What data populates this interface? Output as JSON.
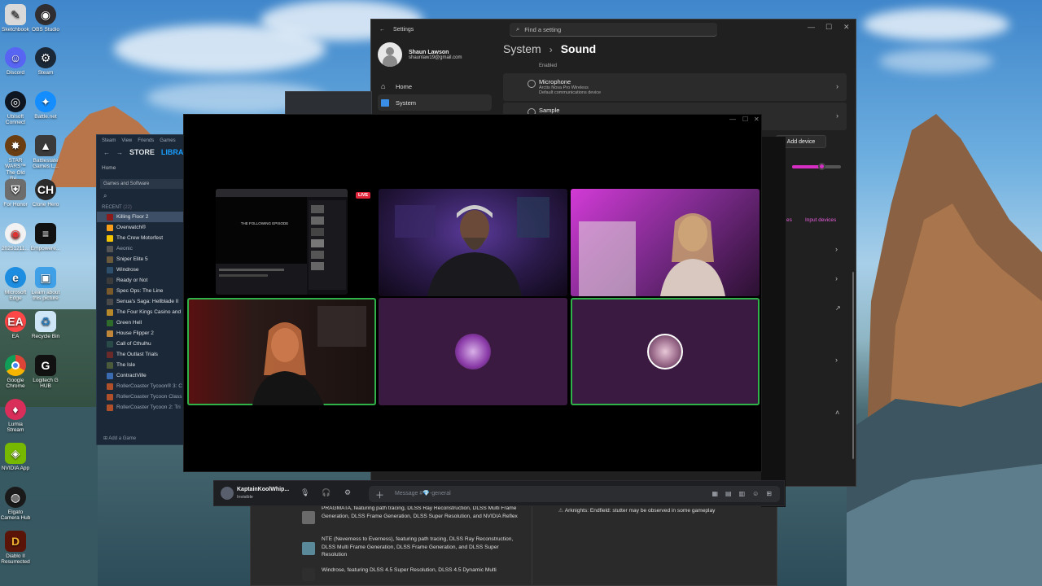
{
  "desktop": {
    "icons": [
      {
        "label": "Sketchbook",
        "icon": "sketch-icon",
        "color": "#d9d9d9"
      },
      {
        "label": "OBS Studio",
        "icon": "obs-icon",
        "color": "#302e31"
      },
      {
        "label": "Discord",
        "icon": "discord-icon",
        "color": "#5865f2"
      },
      {
        "label": "Steam",
        "icon": "steam-icon",
        "color": "#1b2838"
      },
      {
        "label": "Ubisoft Connect",
        "icon": "ubisoft-icon",
        "color": "#0e1621"
      },
      {
        "label": "Battle.net",
        "icon": "battlenet-icon",
        "color": "#148eff"
      },
      {
        "label": "STAR WARS™ The Old Re...",
        "icon": "swtor-icon",
        "color": "#6b3e12"
      },
      {
        "label": "Battlestate Games L...",
        "icon": "battlestate-icon",
        "color": "#3a3a3a"
      },
      {
        "label": "For Honor",
        "icon": "for-honor-icon",
        "color": "#6d6d6d"
      },
      {
        "label": "Clone Hero",
        "icon": "clone-hero-icon",
        "color": "#2b2b2b"
      },
      {
        "label": "20251211...",
        "icon": "chrome-shortcut-icon",
        "color": "#f2f2f2"
      },
      {
        "label": "Empowere...",
        "icon": "empower-icon",
        "color": "#111"
      },
      {
        "label": "Microsoft Edge",
        "icon": "edge-icon",
        "color": "#1c8de0"
      },
      {
        "label": "Learn about this picture",
        "icon": "spotlight-icon",
        "color": "#3fa0e8"
      },
      {
        "label": "EA",
        "icon": "ea-icon",
        "color": "#ff4747"
      },
      {
        "label": "Recycle Bin",
        "icon": "recycle-bin-icon",
        "color": "#cfe6f7"
      },
      {
        "label": "Google Chrome",
        "icon": "chrome-icon",
        "color": "#f2f2f2"
      },
      {
        "label": "Logitech G HUB",
        "icon": "logitech-icon",
        "color": "#111"
      },
      {
        "label": "Lumia Stream",
        "icon": "lumia-icon",
        "color": "#d92d5a"
      },
      {
        "label": "NVIDIA App",
        "icon": "nvidia-icon",
        "color": "#76b900"
      },
      {
        "label": "Elgato Camera Hub",
        "icon": "elgato-icon",
        "color": "#1a1a1a"
      },
      {
        "label": "Diablo II Resurrected",
        "icon": "diablo-icon",
        "color": "#5a1408"
      }
    ]
  },
  "settings": {
    "app_title": "Settings",
    "search_placeholder": "Find a setting",
    "user_name": "Shaun Lawson",
    "user_email": "shaunlaw19@gmail.com",
    "nav": [
      {
        "label": "Home",
        "icon": "home-icon",
        "active": false
      },
      {
        "label": "System",
        "icon": "system-icon",
        "active": true
      }
    ],
    "breadcrumb_parent": "System",
    "breadcrumb_current": "Sound",
    "enabled_label": "Enabled",
    "microphone": {
      "title": "Microphone",
      "subtitle1": "Arctis Nova Pro Wireless",
      "subtitle2": "Default communications device"
    },
    "sample_label": "Sample",
    "add_device_label": "Add device",
    "volume_level": 0.6,
    "input_devices_link": "Input devices",
    "partial_link": "es",
    "accent": "#d62ec3"
  },
  "steam": {
    "menu": [
      "Steam",
      "View",
      "Friends",
      "Games"
    ],
    "tab_store": "STORE",
    "tab_library": "LIBRARY",
    "home_label": "Home",
    "filter_label": "Games and Software",
    "recent_label": "RECENT",
    "recent_count": "(22)",
    "games": [
      {
        "name": "Killing Floor 2",
        "color": "#8b1a1a",
        "selected": true,
        "dim": false
      },
      {
        "name": "Overwatch®",
        "color": "#f99e1a",
        "selected": false,
        "dim": false
      },
      {
        "name": "The Crew Motorfest",
        "color": "#f5c400",
        "selected": false,
        "dim": false
      },
      {
        "name": "Aeonic",
        "color": "#555",
        "selected": false,
        "dim": true
      },
      {
        "name": "Sniper Elite 5",
        "color": "#6b5a3c",
        "selected": false,
        "dim": false
      },
      {
        "name": "Windrose",
        "color": "#2e4f6b",
        "selected": false,
        "dim": false
      },
      {
        "name": "Ready or Not",
        "color": "#3b3b3b",
        "selected": false,
        "dim": false
      },
      {
        "name": "Spec Ops: The Line",
        "color": "#7a5a2a",
        "selected": false,
        "dim": false
      },
      {
        "name": "Senua's Saga: Hellblade II",
        "color": "#4a4a4a",
        "selected": false,
        "dim": false
      },
      {
        "name": "The Four Kings Casino and",
        "color": "#b8892a",
        "selected": false,
        "dim": false
      },
      {
        "name": "Green Hell",
        "color": "#2f6b2a",
        "selected": false,
        "dim": false
      },
      {
        "name": "House Flipper 2",
        "color": "#c0873a",
        "selected": false,
        "dim": false
      },
      {
        "name": "Call of Cthulhu",
        "color": "#2a4a4a",
        "selected": false,
        "dim": false
      },
      {
        "name": "The Outlast Trials",
        "color": "#6b2a2a",
        "selected": false,
        "dim": false
      },
      {
        "name": "The Isle",
        "color": "#4a5a3a",
        "selected": false,
        "dim": false
      },
      {
        "name": "ContractVille",
        "color": "#3a6ab0",
        "selected": false,
        "dim": false
      },
      {
        "name": "RollerCoaster Tycoon® 3: C",
        "color": "#b0502a",
        "selected": false,
        "dim": true
      },
      {
        "name": "RollerCoaster Tycoon Class",
        "color": "#b0502a",
        "selected": false,
        "dim": true
      },
      {
        "name": "RollerCoaster Tycoon 2: Tri",
        "color": "#b0502a",
        "selected": false,
        "dim": true
      }
    ],
    "add_game_label": "Add a Game"
  },
  "call": {
    "live_badge": "LIVE",
    "screen_title": "THE FOLLOWING EPISODE",
    "tiles": [
      {
        "kind": "screen",
        "speaking": false
      },
      {
        "kind": "camera",
        "speaking": false,
        "bg": "#2a1a4a"
      },
      {
        "kind": "camera",
        "speaking": false,
        "bg": "#7a2a8a"
      },
      {
        "kind": "camera",
        "speaking": true,
        "bg": "#3a2a2a"
      },
      {
        "kind": "avatar",
        "speaking": false,
        "bg": "#3a1a40"
      },
      {
        "kind": "avatar",
        "speaking": true,
        "bg": "#3a1a40"
      }
    ],
    "speaking_color": "#2fb348"
  },
  "discord": {
    "username": "KaptainKoolWhip...",
    "status": "Invisible",
    "message_placeholder": "Message #💎-general"
  },
  "nvidia": {
    "entries": [
      {
        "text": "PRAGMATA, featuring path tracing, DLSS Ray Reconstruction, DLSS Multi Frame Generation, DLSS Frame Generation, DLSS Super Resolution, and NVIDIA Reflex",
        "thumb_color": "#6a6a6a"
      },
      {
        "text": "NTE (Neverness to Everness), featuring path tracing, DLSS Ray Reconstruction, DLSS Multi Frame Generation, DLSS Frame Generation, and DLSS Super Resolution",
        "thumb_color": "#5a8a9a"
      },
      {
        "text": "Windrose, featuring DLSS 4.5 Super Resolution, DLSS 4.5 Dynamic Multi",
        "thumb_color": "#2e2e2e"
      }
    ],
    "known_issue": "Arknights: Endfield: stutter may be observed in some gameplay"
  }
}
